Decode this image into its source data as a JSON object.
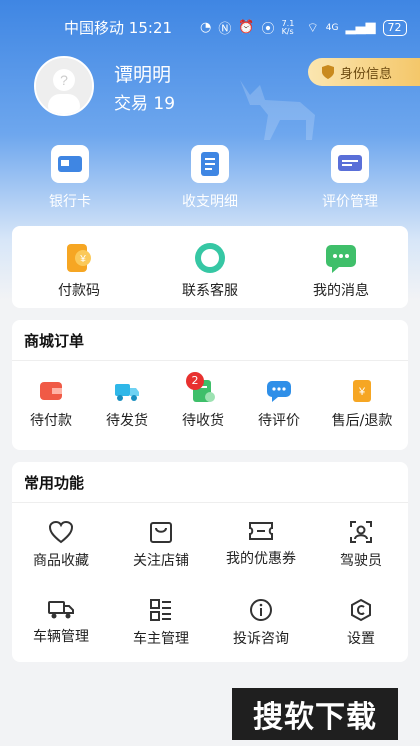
{
  "status": {
    "carrier": "中国移动",
    "time": "15:21",
    "net": "7.1 K/s",
    "signal": "4G",
    "battery": "72"
  },
  "profile": {
    "name": "谭明明",
    "trade": "交易 19",
    "id_button": "身份信息"
  },
  "top": [
    {
      "label": "银行卡",
      "icon": "bank-card-icon"
    },
    {
      "label": "收支明细",
      "icon": "bill-detail-icon"
    },
    {
      "label": "评价管理",
      "icon": "review-icon"
    }
  ],
  "quick": [
    {
      "label": "付款码",
      "icon": "pay-code-icon"
    },
    {
      "label": "联系客服",
      "icon": "customer-service-icon"
    },
    {
      "label": "我的消息",
      "icon": "message-icon"
    }
  ],
  "orders": {
    "title": "商城订单",
    "items": [
      {
        "label": "待付款"
      },
      {
        "label": "待发货"
      },
      {
        "label": "待收货",
        "badge": "2"
      },
      {
        "label": "待评价"
      },
      {
        "label": "售后/退款"
      }
    ]
  },
  "functions": {
    "title": "常用功能",
    "items": [
      {
        "label": "商品收藏"
      },
      {
        "label": "关注店铺"
      },
      {
        "label": "我的优惠券"
      },
      {
        "label": "驾驶员"
      },
      {
        "label": "车辆管理"
      },
      {
        "label": "车主管理"
      },
      {
        "label": "投诉咨询"
      },
      {
        "label": "设置"
      }
    ]
  },
  "watermark": "搜软下载",
  "colors": {
    "accent": "#3f86e3",
    "badge": "#e8312f",
    "gold": "#f4c76a"
  }
}
